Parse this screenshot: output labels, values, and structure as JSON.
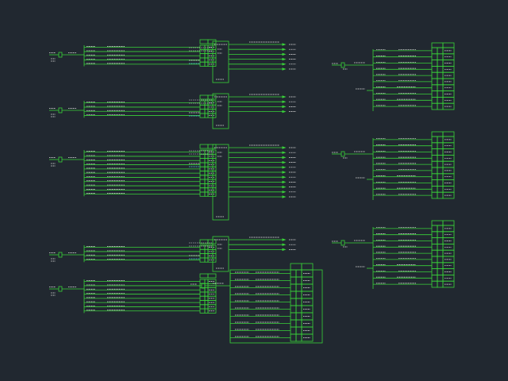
{
  "colors": {
    "background": "#212830",
    "line_green": "#39d239",
    "text_white": "#e8e8e8",
    "text_cyan": "#4fd0e8"
  },
  "panel_header": {
    "col1": "",
    "col2": ""
  },
  "left_panels": [
    {
      "id": "L1",
      "rows": 5
    },
    {
      "id": "L2",
      "rows": 4
    },
    {
      "id": "L3",
      "rows": 11
    },
    {
      "id": "L4",
      "rows": 4
    },
    {
      "id": "L5",
      "rows": 8
    }
  ],
  "mid_panels": [
    {
      "id": "M1",
      "rows": 6
    },
    {
      "id": "M2",
      "rows": 4
    },
    {
      "id": "M3",
      "rows": 11
    },
    {
      "id": "M4",
      "rows": 3
    },
    {
      "id": "M5",
      "rows": 10
    }
  ],
  "right_panels": [
    {
      "id": "R1",
      "rows": 10
    },
    {
      "id": "R2",
      "rows": 10
    },
    {
      "id": "R3",
      "rows": 10
    }
  ]
}
